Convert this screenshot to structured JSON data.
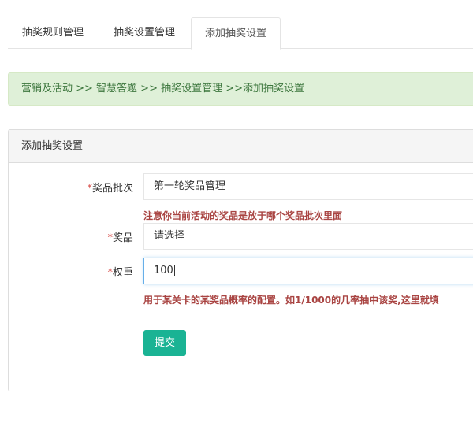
{
  "tabs": [
    {
      "label": "抽奖规则管理"
    },
    {
      "label": "抽奖设置管理"
    },
    {
      "label": "添加抽奖设置"
    }
  ],
  "breadcrumb": {
    "text": "营销及活动 >> 智慧答题 >> 抽奖设置管理 >>添加抽奖设置"
  },
  "panel": {
    "title": "添加抽奖设置"
  },
  "form": {
    "batch": {
      "required": "*",
      "label": "奖品批次",
      "value": "第一轮奖品管理",
      "help": "注意你当前活动的奖品是放于哪个奖品批次里面"
    },
    "prize": {
      "required": "*",
      "label": "奖品",
      "value": "请选择"
    },
    "weight": {
      "required": "*",
      "label": "权重",
      "value": "100",
      "help": "用于某关卡的某奖品概率的配置。如1/1000的几率抽中该奖,这里就填"
    },
    "submit_label": "提交"
  },
  "colors": {
    "accent": "#1ab394",
    "breadcrumb_bg": "#dff0d8",
    "help_text": "#a94442",
    "required": "#d9534f"
  }
}
